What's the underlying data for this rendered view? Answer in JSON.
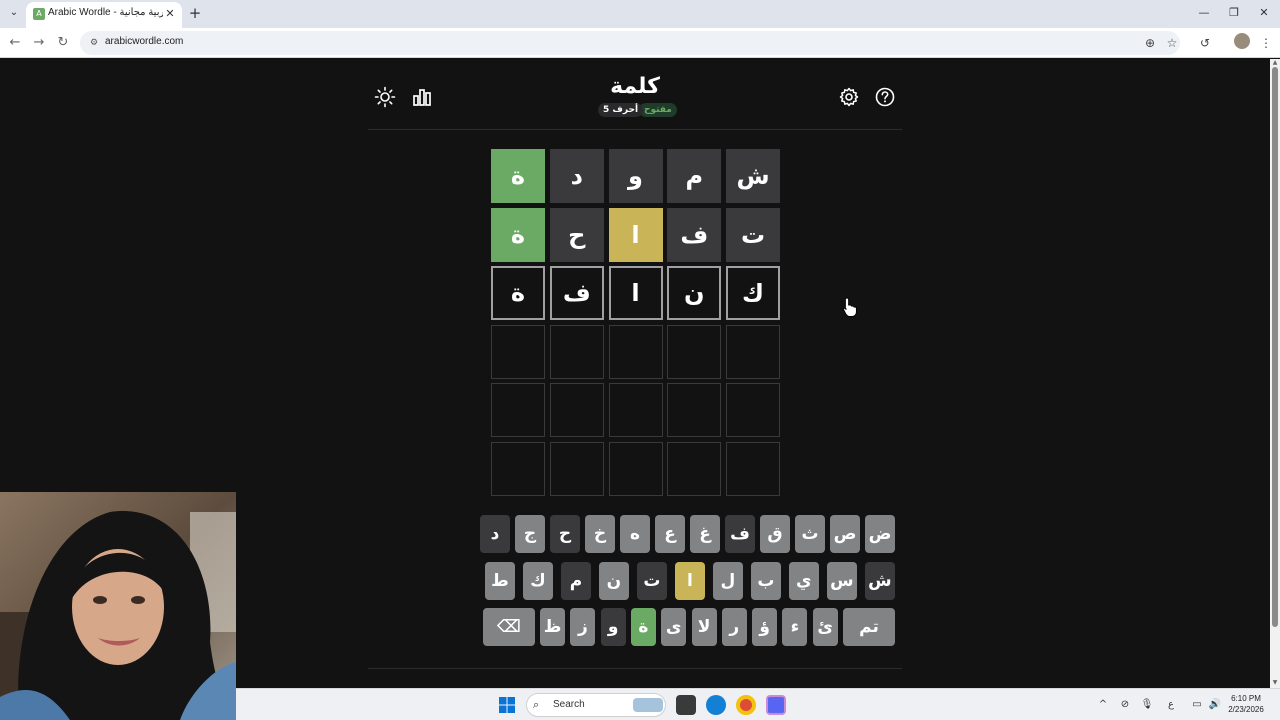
{
  "browser": {
    "tab_title": "Arabic Wordle - ل عربية مجانية",
    "tab_close": "✕",
    "new_tab": "+",
    "url": "arabicwordle.com",
    "controls": {
      "minimize": "—",
      "restore": "❐",
      "close": "✕"
    }
  },
  "game": {
    "title": "كلمة",
    "mode_badge": "مفتوح",
    "length_badge": "5 أحرف"
  },
  "board": {
    "rows": [
      [
        {
          "l": "ش",
          "s": "absent"
        },
        {
          "l": "م",
          "s": "absent"
        },
        {
          "l": "و",
          "s": "absent"
        },
        {
          "l": "د",
          "s": "absent"
        },
        {
          "l": "ة",
          "s": "correct"
        }
      ],
      [
        {
          "l": "ت",
          "s": "absent"
        },
        {
          "l": "ف",
          "s": "absent"
        },
        {
          "l": "ا",
          "s": "present"
        },
        {
          "l": "ح",
          "s": "absent"
        },
        {
          "l": "ة",
          "s": "correct"
        }
      ],
      [
        {
          "l": "ك",
          "s": "filled"
        },
        {
          "l": "ن",
          "s": "filled"
        },
        {
          "l": "ا",
          "s": "filled"
        },
        {
          "l": "ف",
          "s": "filled"
        },
        {
          "l": "ة",
          "s": "filled"
        }
      ],
      [
        {
          "l": "",
          "s": "empty"
        },
        {
          "l": "",
          "s": "empty"
        },
        {
          "l": "",
          "s": "empty"
        },
        {
          "l": "",
          "s": "empty"
        },
        {
          "l": "",
          "s": "empty"
        }
      ],
      [
        {
          "l": "",
          "s": "empty"
        },
        {
          "l": "",
          "s": "empty"
        },
        {
          "l": "",
          "s": "empty"
        },
        {
          "l": "",
          "s": "empty"
        },
        {
          "l": "",
          "s": "empty"
        }
      ],
      [
        {
          "l": "",
          "s": "empty"
        },
        {
          "l": "",
          "s": "empty"
        },
        {
          "l": "",
          "s": "empty"
        },
        {
          "l": "",
          "s": "empty"
        },
        {
          "l": "",
          "s": "empty"
        }
      ]
    ]
  },
  "keyboard": {
    "rows": [
      [
        {
          "l": "ض",
          "s": "normal"
        },
        {
          "l": "ص",
          "s": "normal"
        },
        {
          "l": "ث",
          "s": "normal"
        },
        {
          "l": "ق",
          "s": "normal"
        },
        {
          "l": "ف",
          "s": "absent"
        },
        {
          "l": "غ",
          "s": "normal"
        },
        {
          "l": "ع",
          "s": "normal"
        },
        {
          "l": "ه",
          "s": "normal"
        },
        {
          "l": "خ",
          "s": "normal"
        },
        {
          "l": "ح",
          "s": "absent"
        },
        {
          "l": "ج",
          "s": "normal"
        },
        {
          "l": "د",
          "s": "absent"
        }
      ],
      [
        {
          "l": "ش",
          "s": "absent"
        },
        {
          "l": "س",
          "s": "normal"
        },
        {
          "l": "ي",
          "s": "normal"
        },
        {
          "l": "ب",
          "s": "normal"
        },
        {
          "l": "ل",
          "s": "normal"
        },
        {
          "l": "ا",
          "s": "present"
        },
        {
          "l": "ت",
          "s": "absent"
        },
        {
          "l": "ن",
          "s": "normal"
        },
        {
          "l": "م",
          "s": "absent"
        },
        {
          "l": "ك",
          "s": "normal"
        },
        {
          "l": "ط",
          "s": "normal"
        }
      ],
      [
        {
          "l": "تم",
          "s": "normal",
          "wide": true
        },
        {
          "l": "ئ",
          "s": "normal"
        },
        {
          "l": "ء",
          "s": "normal"
        },
        {
          "l": "ؤ",
          "s": "normal"
        },
        {
          "l": "ر",
          "s": "normal"
        },
        {
          "l": "لا",
          "s": "normal"
        },
        {
          "l": "ى",
          "s": "normal"
        },
        {
          "l": "ة",
          "s": "correct"
        },
        {
          "l": "و",
          "s": "absent"
        },
        {
          "l": "ز",
          "s": "normal"
        },
        {
          "l": "ظ",
          "s": "normal"
        },
        {
          "l": "⌫",
          "s": "normal",
          "wide": true
        }
      ]
    ]
  },
  "taskbar": {
    "search_placeholder": "Search",
    "time": "6:10 PM",
    "date": "2/23/2026",
    "lang": "ع"
  },
  "colors": {
    "correct": "#6aaa64",
    "present": "#c9b458",
    "absent": "#3a3a3c",
    "key": "#818384",
    "background": "#121213"
  }
}
